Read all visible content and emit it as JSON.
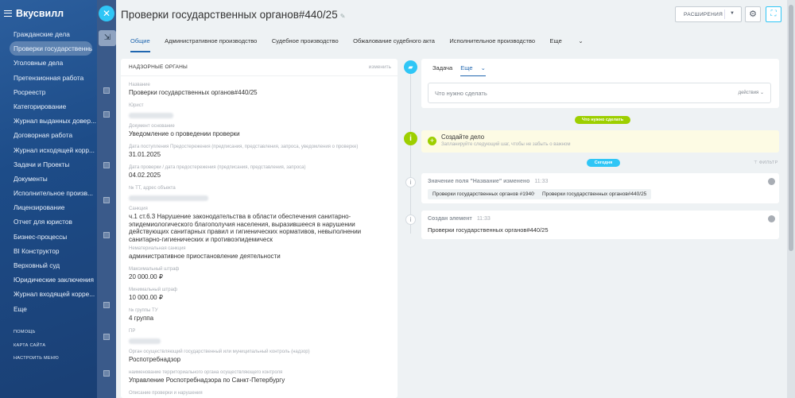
{
  "sidebar": {
    "brand": "Вкусвилл",
    "items": [
      "Гражданские дела",
      "Проверки государственных...",
      "Уголовные дела",
      "Претензионная работа",
      "Росреестр",
      "Категорирование",
      "Журнал выданных довер...",
      "Договорная работа",
      "Журнал исходящей корр...",
      "Задачи и Проекты",
      "Документы",
      "Исполнительное произв...",
      "Лицензирование",
      "Отчет для юристов",
      "Бизнес-процессы",
      "BI Конструктор",
      "Верховный суд",
      "Юридические заключения",
      "Журнал входящей корре...",
      "Еще"
    ],
    "active_index": 1,
    "bottom_links": [
      "ПОМОЩЬ",
      "КАРТА САЙТА",
      "НАСТРОИТЬ МЕНЮ"
    ]
  },
  "header": {
    "title": "Проверки государственных органов#440/25",
    "extensions_label": "РАСШИРЕНИЯ"
  },
  "tabs": [
    "Общие",
    "Административное производство",
    "Судебное производство",
    "Обжалование судебного акта",
    "Исполнительное производство",
    "Еще"
  ],
  "card": {
    "heading": "НАДЗОРНЫЕ ОРГАНЫ",
    "edit_label": "изменить",
    "fields": [
      {
        "label": "Название",
        "value": "Проверки государственных органов#440/25"
      },
      {
        "label": "Юрист",
        "value": ""
      },
      {
        "label": "Документ основание",
        "value": "Уведомление о проведении проверки"
      },
      {
        "label": "Дата поступления Предостережения (предписания, представления, запроса, уведомления о проверке)",
        "value": "31.01.2025"
      },
      {
        "label": "Дата проверки / дата предостережения (предписания, представления, запроса)",
        "value": "04.02.2025"
      },
      {
        "label": "№ ТТ, адрес объекта",
        "value": ""
      },
      {
        "label": "Санкция",
        "value": "ч.1 ст.6.3 Нарушение законодательства в области обеспечения санитарно-эпидемиологического благополучия населения, выразившееся в нарушении действующих санитарных правил и гигиенических нормативов, невыполнении санитарно-гигиенических и противоэпидемическ"
      },
      {
        "label": "Нематериальная санкция",
        "value": "административное приостановление деятельности"
      },
      {
        "label": "Максимальный штраф",
        "value": "20 000.00 ₽"
      },
      {
        "label": "Минимальный штраф",
        "value": "10 000.00 ₽"
      },
      {
        "label": "№ группы ТУ",
        "value": "4 группа"
      },
      {
        "label": "ПР",
        "value": ""
      },
      {
        "label": "Орган осуществляющий государственный или муниципальный контроль (надзор)",
        "value": "Роспотребнадзор"
      },
      {
        "label": "наименование территориального органа осуществляющего контроля",
        "value": "Управление Роспотребнадзора по Санкт-Петербургу"
      },
      {
        "label": "Описание проверки и нарушения",
        "value": ""
      }
    ]
  },
  "timeline": {
    "task_tabs": [
      "Задача",
      "Еще"
    ],
    "task_placeholder": "Что нужно сделать",
    "actions_label": "действия",
    "todo_pill": "Что нужно сделать",
    "create": {
      "title": "Создайте дело",
      "subtitle": "Запланируйте следующий шаг, чтобы не забыть о важном"
    },
    "today_pill": "Сегодня",
    "filter_label": "ФИЛЬТР",
    "events": [
      {
        "title": "Значение поля \"Название\" изменено",
        "time": "11:33",
        "old": "Проверки государственных органов #1940",
        "new": "Проверки государственных органов#440/25"
      },
      {
        "title": "Создан элемент",
        "time": "11:33",
        "body": "Проверки государственных органов#440/25"
      }
    ]
  },
  "colors": {
    "accent": "#2067b0",
    "green": "#9dcf00",
    "cyan": "#2fc6f6"
  }
}
